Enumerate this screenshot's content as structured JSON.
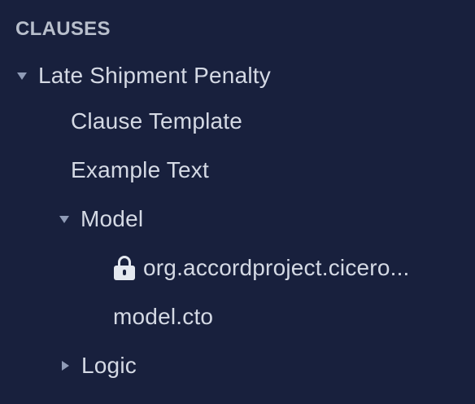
{
  "header": {
    "title": "CLAUSES"
  },
  "tree": {
    "root": {
      "label": "Late Shipment Penalty",
      "expanded": true
    },
    "clause_template": {
      "label": "Clause Template"
    },
    "example_text": {
      "label": "Example Text"
    },
    "model": {
      "label": "Model",
      "expanded": true
    },
    "model_files": [
      {
        "label": "org.accordproject.cicero...",
        "icon": "lock-icon",
        "locked": true
      },
      {
        "label": "model.cto",
        "locked": false
      }
    ],
    "logic": {
      "label": "Logic",
      "expanded": false
    }
  },
  "colors": {
    "background": "#18203d",
    "text": "#d4d9e4",
    "header": "#b8bfcc",
    "caret": "#8f9bb6"
  }
}
